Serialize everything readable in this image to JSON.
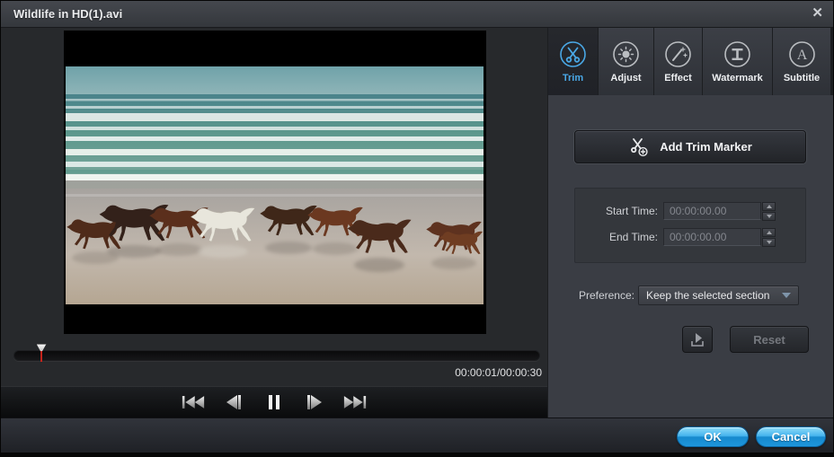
{
  "window": {
    "title": "Wildlife in HD(1).avi",
    "close_glyph": "✕"
  },
  "player": {
    "time_display": "00:00:01/00:00:30",
    "progress_percent": 5.3
  },
  "tabs": [
    {
      "label": "Trim",
      "selected": true
    },
    {
      "label": "Adjust",
      "selected": false
    },
    {
      "label": "Effect",
      "selected": false
    },
    {
      "label": "Watermark",
      "selected": false
    },
    {
      "label": "Subtitle",
      "selected": false
    }
  ],
  "trim": {
    "add_marker": "Add Trim Marker",
    "start_label": "Start Time:",
    "start_value": "00:00:00.00",
    "end_label": "End Time:",
    "end_value": "00:00:00.00",
    "pref_label": "Preference:",
    "pref_value": "Keep the selected section",
    "reset": "Reset"
  },
  "footer": {
    "ok": "OK",
    "cancel": "Cancel"
  },
  "colors": {
    "accent_blue": "#4aa8e6",
    "action_button_blue": "#1e96dc",
    "playhead_red": "#c4241c"
  }
}
